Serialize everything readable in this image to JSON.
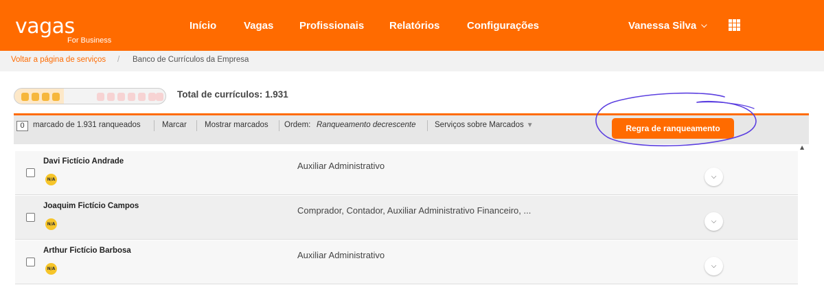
{
  "brand": {
    "logo": "vagas",
    "logo_sub": "For Business"
  },
  "nav": {
    "items": [
      "Início",
      "Vagas",
      "Profissionais",
      "Relatórios",
      "Configurações"
    ],
    "user": "Vanessa Silva"
  },
  "breadcrumb": {
    "back_link": "Voltar a página de serviços",
    "separator": "/",
    "current": "Banco de Currículos da Empresa"
  },
  "summary": {
    "total_label": "Total de currículos: 1.931",
    "meter_filled_segments": 4,
    "meter_total_segments": 11
  },
  "toolbar": {
    "marked_count": "0",
    "marked_text": "marcado de 1.931 ranqueados",
    "mark": "Marcar",
    "show_marked": "Mostrar marcados",
    "order_label": "Ordem:",
    "order_value": "Ranqueamento decrescente",
    "services": "Serviços sobre Marcados",
    "ranking_rule_button": "Regra de ranqueamento"
  },
  "candidates": [
    {
      "name": "Davi Fictício Andrade",
      "badge": "N/A",
      "roles": "Auxiliar Administrativo"
    },
    {
      "name": "Joaquim Fictício Campos",
      "badge": "N/A",
      "roles": "Comprador, Contador, Auxiliar Administrativo Financeiro, ..."
    },
    {
      "name": "Arthur Fictício Barbosa",
      "badge": "N/A",
      "roles": "Auxiliar Administrativo"
    }
  ],
  "colors": {
    "brand_orange": "#ff6b00",
    "annotation_purple": "#5b3fe0",
    "badge_yellow": "#f6c52a"
  },
  "icons": {
    "user_menu": "chevron-down-icon",
    "apps": "grid-icon",
    "row_expand": "chevron-down-circle-icon",
    "services_caret": "triangle-down-icon"
  }
}
